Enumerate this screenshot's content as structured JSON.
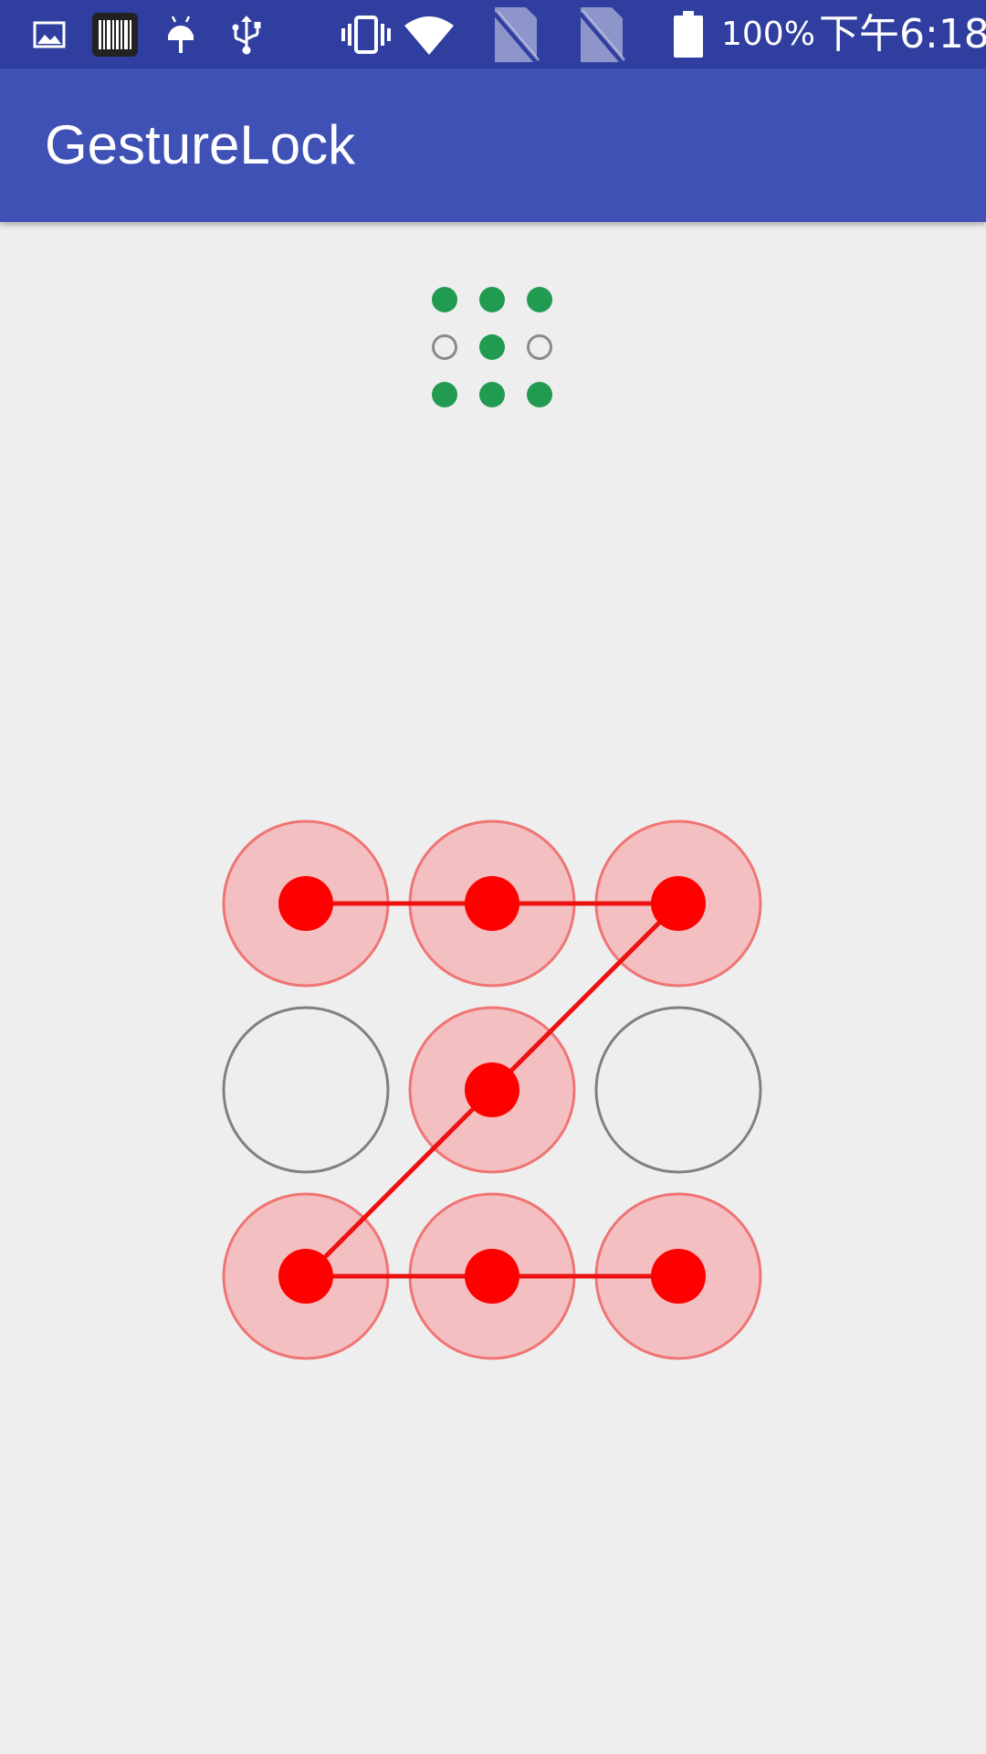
{
  "status_bar": {
    "icons": [
      "image-icon",
      "barcode-icon",
      "android-debug-icon",
      "usb-icon",
      "vibrate-icon",
      "wifi-icon",
      "no-sim-icon",
      "no-sim-icon"
    ],
    "battery_text": "100%",
    "time": "下午6:18"
  },
  "app_bar": {
    "title": "GestureLock"
  },
  "pattern_preview": {
    "cells": [
      true,
      true,
      true,
      false,
      true,
      false,
      true,
      true,
      true
    ],
    "on_color": "#219a52",
    "off_color": "#8a8a8a"
  },
  "gesture_lock": {
    "selected": [
      true,
      true,
      true,
      false,
      true,
      false,
      true,
      true,
      true
    ],
    "path": [
      0,
      1,
      2,
      4,
      6,
      7,
      8
    ],
    "selected_fill": "#f3bfc0",
    "selected_stroke": "#f07474",
    "dot_color": "#ff0000",
    "line_color": "#ee1111",
    "idle_stroke": "#808080"
  },
  "colors": {
    "status_bar": "#303f9f",
    "app_bar": "#3f51b5",
    "background": "#eeeeee"
  }
}
